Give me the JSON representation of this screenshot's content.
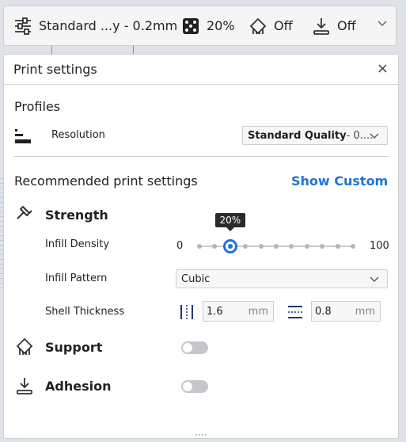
{
  "topbar": {
    "profile_label": "Standard ...y - 0.2mm",
    "infill_label": "20%",
    "support_label": "Off",
    "adhesion_label": "Off"
  },
  "panel": {
    "title": "Print settings",
    "close_glyph": "×",
    "profiles": {
      "heading": "Profiles",
      "resolution_label": "Resolution",
      "resolution_value_bold": "Standard Quality",
      "resolution_value_rest": " - 0...."
    },
    "recommended": {
      "heading": "Recommended print settings",
      "show_custom": "Show Custom"
    },
    "strength": {
      "heading": "Strength",
      "infill_density_label": "Infill Density",
      "slider_min": "0",
      "slider_max": "100",
      "slider_value": 20,
      "slider_tooltip": "20%",
      "infill_pattern_label": "Infill Pattern",
      "infill_pattern_value": "Cubic",
      "shell_thickness_label": "Shell Thickness",
      "wall_thickness": "1.6",
      "top_bottom_thickness": "0.8",
      "unit": "mm"
    },
    "support": {
      "heading": "Support",
      "enabled": false
    },
    "adhesion": {
      "heading": "Adhesion",
      "enabled": false
    }
  },
  "colors": {
    "accent": "#1f74d2",
    "toggle_off": "#c6c6ca"
  },
  "icons": {
    "profile": "sliders-icon",
    "infill": "dice-infill-icon",
    "support": "support-icon",
    "adhesion": "adhesion-icon",
    "resolution": "layer-height-icon",
    "strength": "hammer-icon",
    "wall": "wall-thickness-icon",
    "topbottom": "top-bottom-thickness-icon"
  }
}
